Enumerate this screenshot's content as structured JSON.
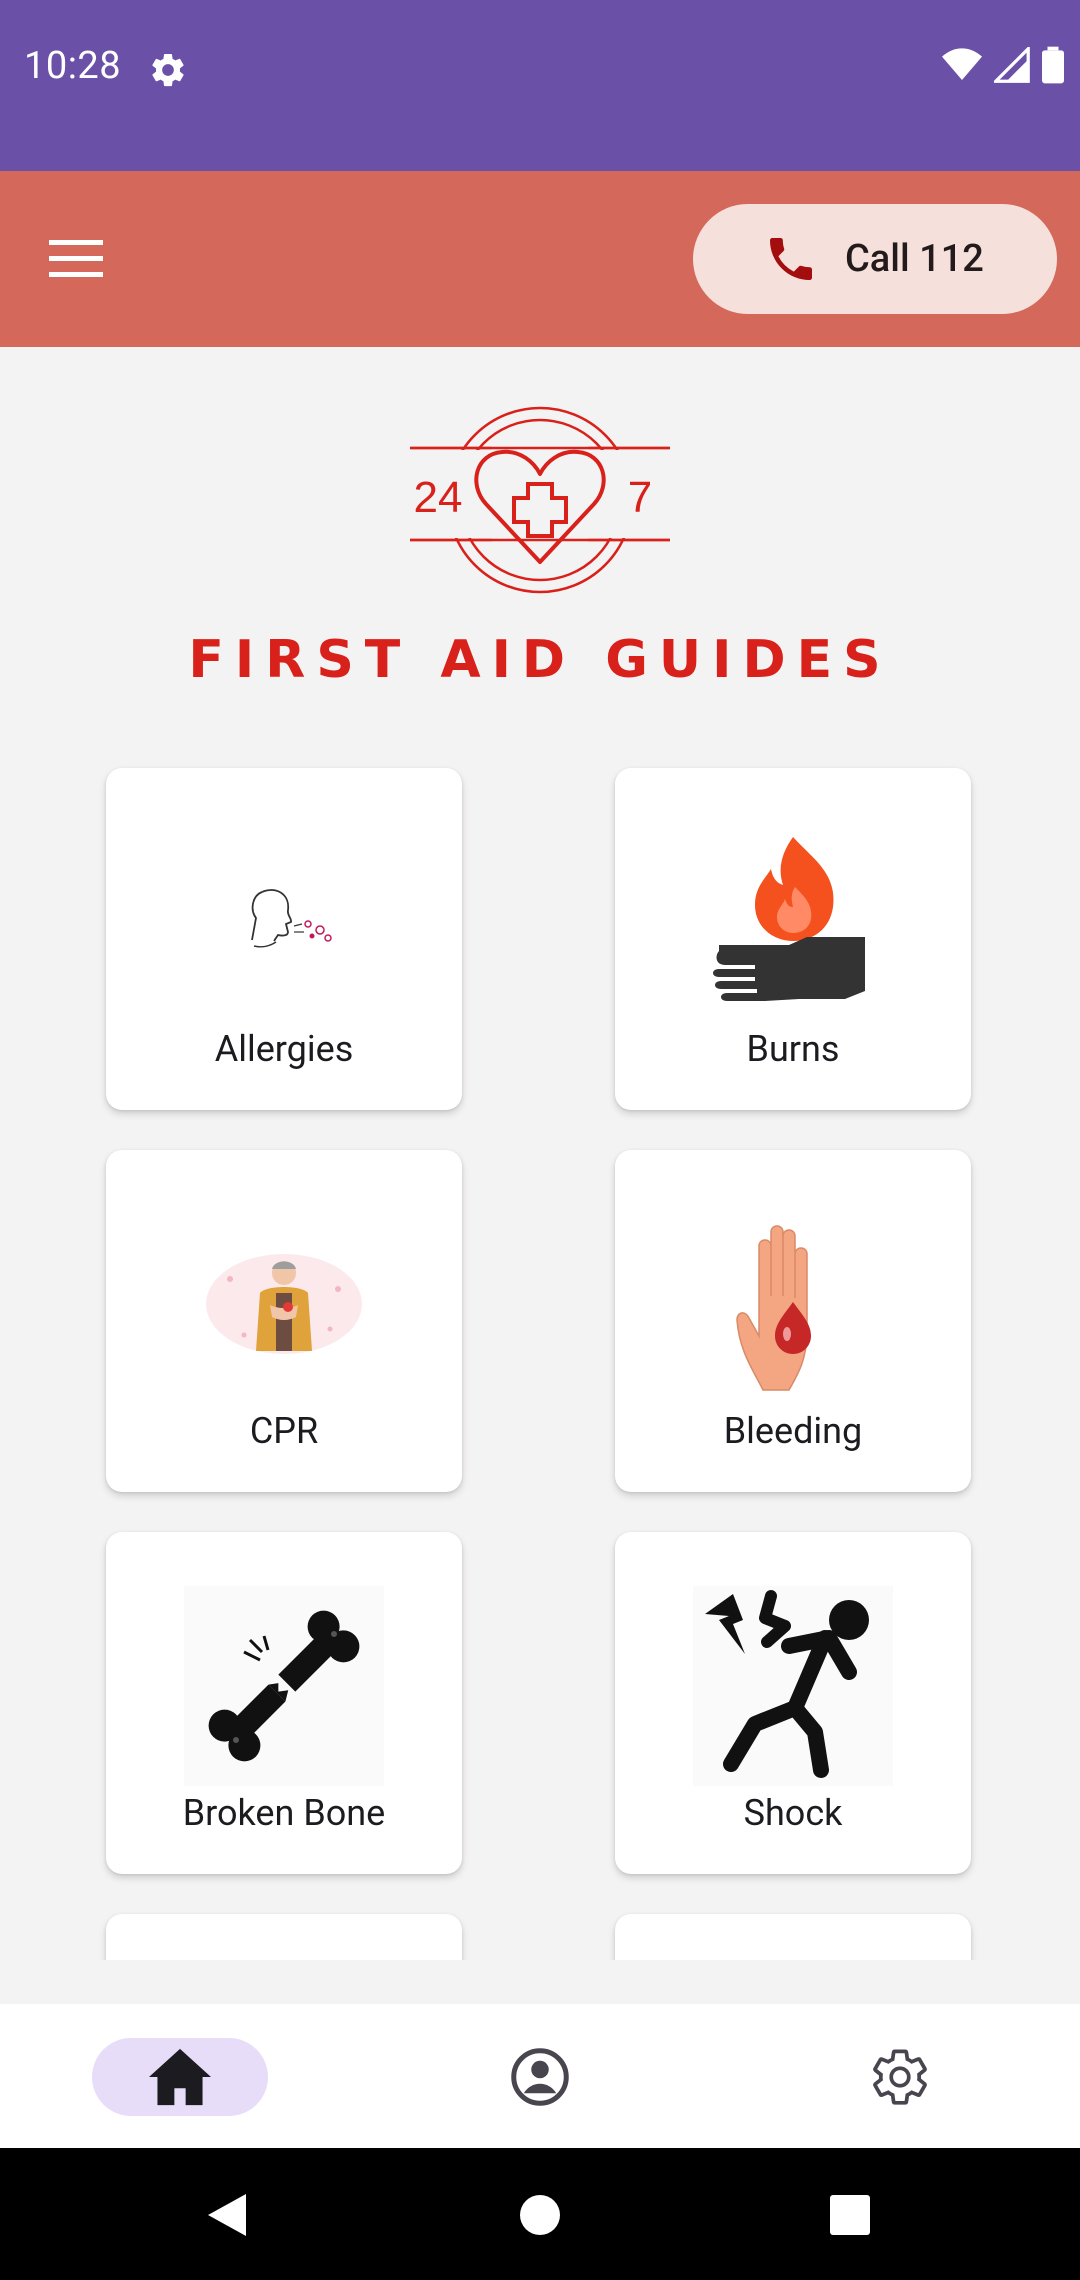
{
  "status": {
    "time": "10:28"
  },
  "header": {
    "call_label": "Call 112"
  },
  "logo": {
    "left_number": "24",
    "right_number": "7",
    "title": "FIRST AID GUIDES"
  },
  "guides": [
    {
      "label": "Allergies",
      "icon": "sneezing-person-icon"
    },
    {
      "label": "Burns",
      "icon": "burning-hand-icon"
    },
    {
      "label": "CPR",
      "icon": "chest-pain-person-icon"
    },
    {
      "label": "Bleeding",
      "icon": "bleeding-hand-icon"
    },
    {
      "label": "Broken Bone",
      "icon": "broken-bone-icon"
    },
    {
      "label": "Shock",
      "icon": "electric-shock-icon"
    }
  ],
  "bottom_nav": {
    "active": "home",
    "items": [
      "home",
      "profile",
      "settings"
    ]
  },
  "colors": {
    "status_bar": "#6a51a7",
    "app_bar": "#d4685b",
    "call_button": "#f6e0dc",
    "logo_red": "#d8211b",
    "nav_active": "#e8ddf8"
  }
}
